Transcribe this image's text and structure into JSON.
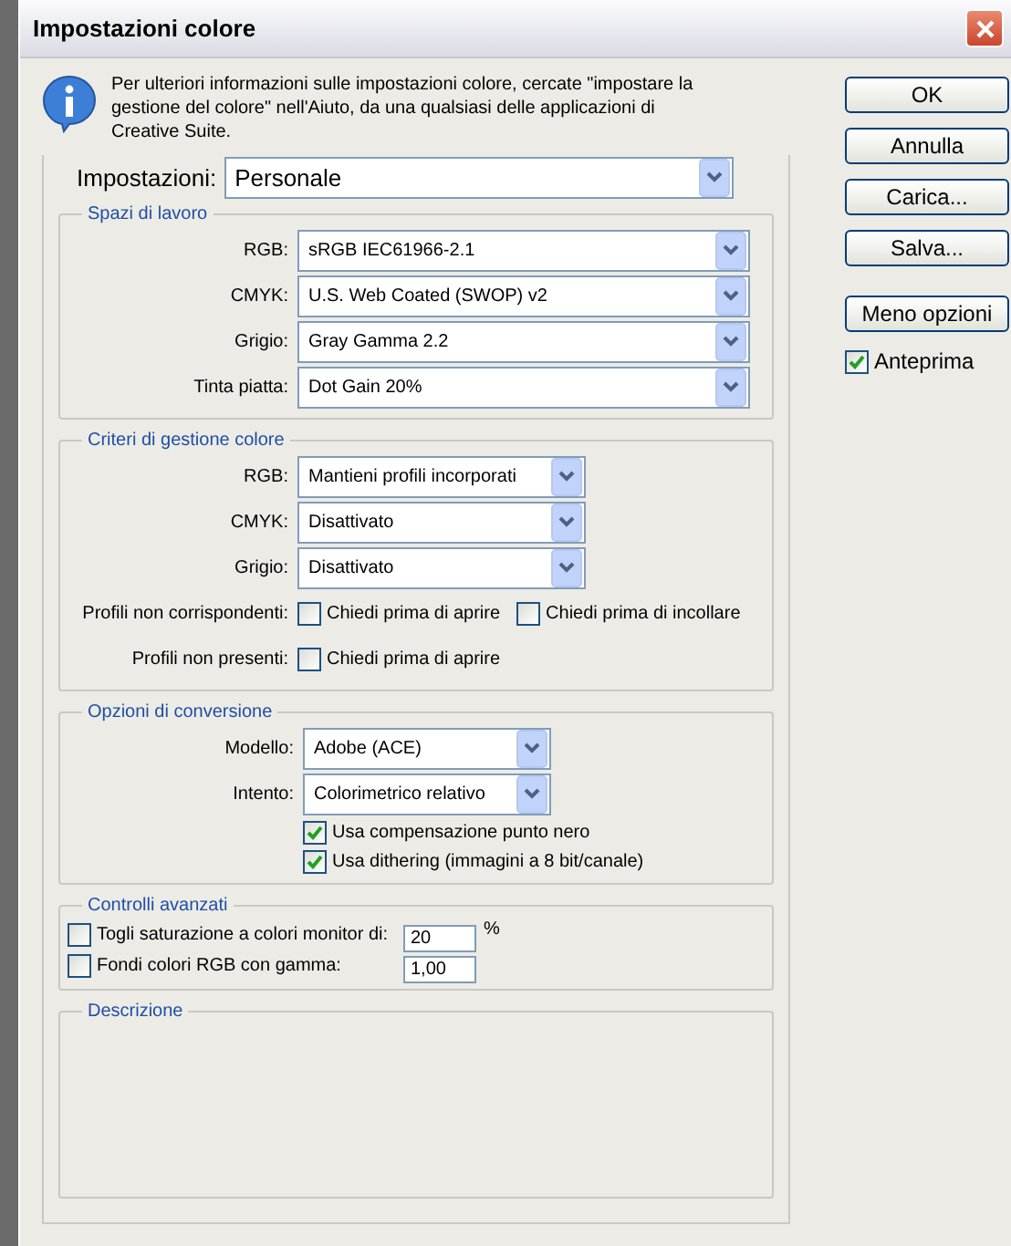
{
  "window": {
    "title": "Impostazioni colore"
  },
  "info": {
    "text": "Per ulteriori informazioni sulle impostazioni colore, cercate \"impostare la gestione del colore\" nell'Aiuto, da una qualsiasi delle applicazioni di Creative Suite."
  },
  "settings": {
    "label": "Impostazioni:",
    "value": "Personale"
  },
  "sections": [
    {
      "kind": "workspaces",
      "title": "Spazi di lavoro",
      "rows": [
        {
          "kind": "select",
          "label": "RGB:",
          "value": "sRGB IEC61966-2.1"
        },
        {
          "kind": "select",
          "label": "CMYK:",
          "value": "U.S. Web Coated (SWOP) v2"
        },
        {
          "kind": "select",
          "label": "Grigio:",
          "value": "Gray Gamma 2.2"
        },
        {
          "kind": "select",
          "label": "Tinta piatta:",
          "value": "Dot Gain 20%"
        }
      ]
    },
    {
      "kind": "policies",
      "title": "Criteri di gestione colore",
      "rows": [
        {
          "kind": "select",
          "label": "RGB:",
          "value": "Mantieni profili incorporati"
        },
        {
          "kind": "select",
          "label": "CMYK:",
          "value": "Disattivato"
        },
        {
          "kind": "select",
          "label": "Grigio:",
          "value": "Disattivato"
        },
        {
          "kind": "checkboxes",
          "label": "Profili non corrispondenti:",
          "items": [
            {
              "label": "Chiedi prima di aprire",
              "checked": false
            },
            {
              "label": "Chiedi prima di incollare",
              "checked": false
            }
          ]
        },
        {
          "kind": "checkboxes",
          "label": "Profili non presenti:",
          "items": [
            {
              "label": "Chiedi prima di aprire",
              "checked": false
            }
          ]
        }
      ]
    },
    {
      "kind": "conversion",
      "title": "Opzioni di conversione",
      "rows": [
        {
          "kind": "select",
          "label": "Modello:",
          "value": "Adobe (ACE)"
        },
        {
          "kind": "select",
          "label": "Intento:",
          "value": "Colorimetrico relativo"
        },
        {
          "kind": "checkbox",
          "label": "Usa compensazione punto nero",
          "checked": true
        },
        {
          "kind": "checkbox",
          "label": "Usa dithering (immagini a 8 bit/canale)",
          "checked": true
        }
      ]
    },
    {
      "kind": "advanced",
      "title": "Controlli avanzati",
      "rows": [
        {
          "kind": "input",
          "label": "Togli saturazione a colori monitor di:",
          "checked": false,
          "value": "20",
          "unit": "%"
        },
        {
          "kind": "input",
          "label": "Fondi colori RGB con gamma:",
          "checked": false,
          "value": "1,00"
        }
      ]
    },
    {
      "kind": "description",
      "title": "Descrizione"
    }
  ],
  "buttons": [
    "OK",
    "Annulla",
    "Carica...",
    "Salva..."
  ],
  "toggle_button": "Meno opzioni",
  "preview": {
    "label": "Anteprima",
    "checked": true
  }
}
